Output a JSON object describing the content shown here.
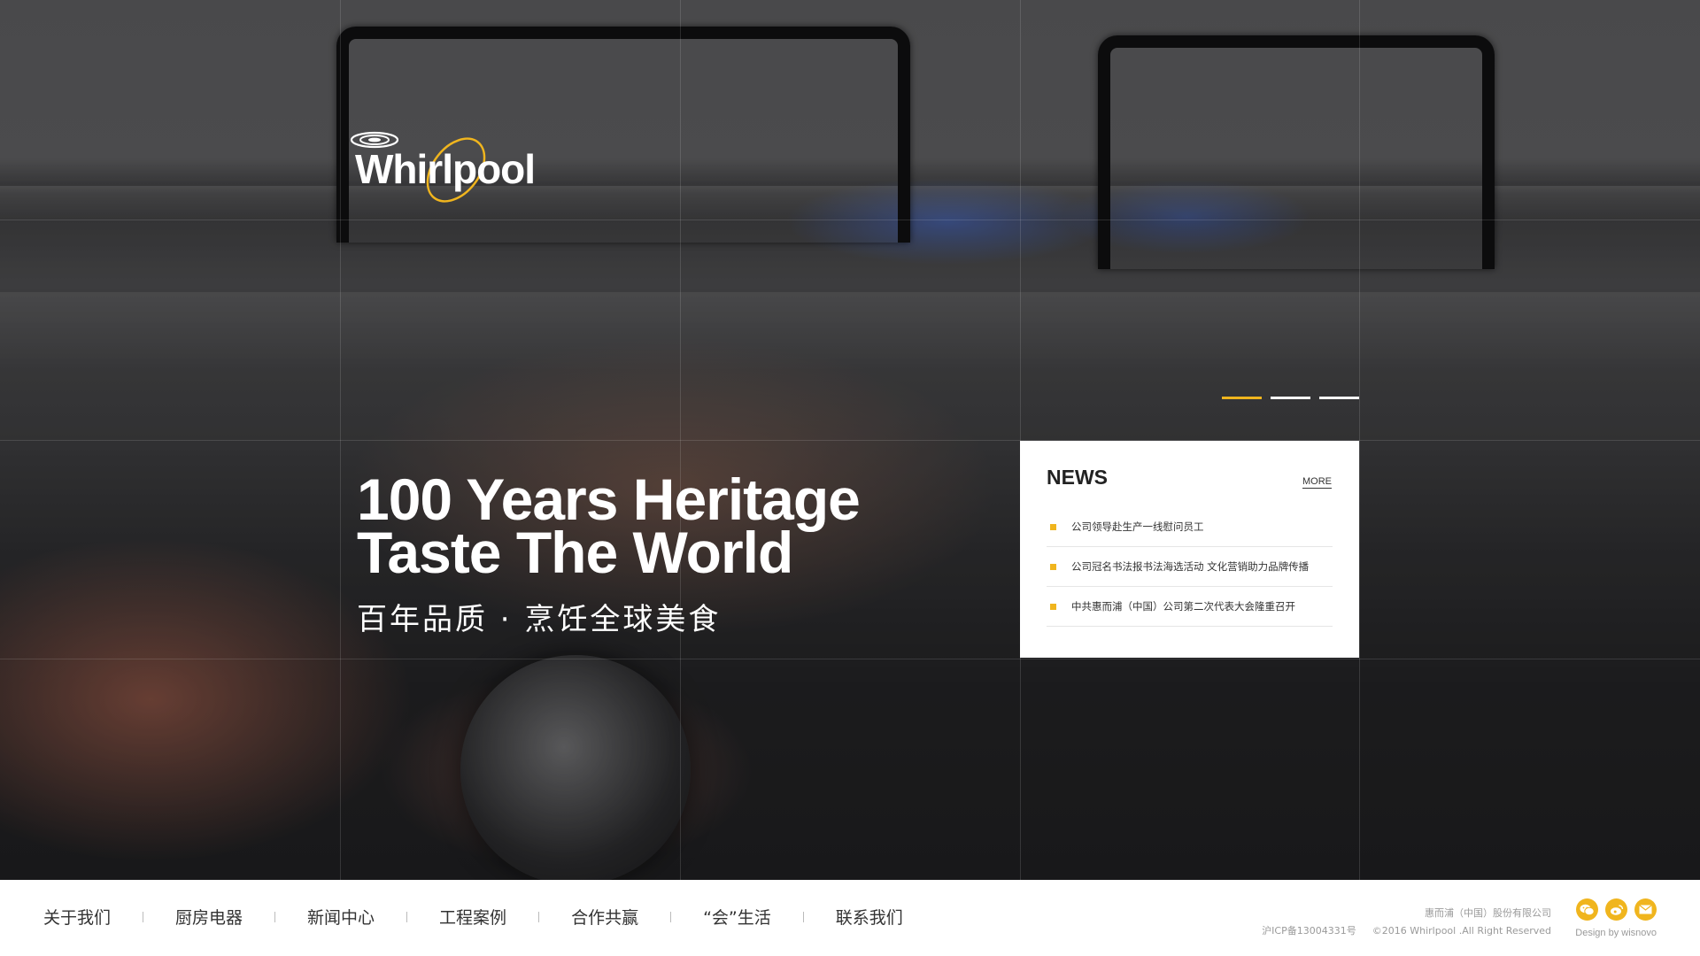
{
  "brand": {
    "logo_text": "Whirlpool"
  },
  "hero": {
    "headline_line1": "100 Years Heritage",
    "headline_line2": "Taste The World",
    "subtitle": "百年品质 · 烹饪全球美食",
    "slides_total": 3,
    "active_slide": 1
  },
  "news": {
    "title": "NEWS",
    "more_label": "MORE",
    "items": [
      {
        "title": "公司领导赴生产一线慰问员工"
      },
      {
        "title": "公司冠名书法报书法海选活动 文化营销助力品牌传播"
      },
      {
        "title": "中共惠而浦（中国）公司第二次代表大会隆重召开"
      }
    ]
  },
  "footer": {
    "nav": [
      {
        "label": "关于我们"
      },
      {
        "label": "厨房电器"
      },
      {
        "label": "新闻中心"
      },
      {
        "label": "工程案例"
      },
      {
        "label": "合作共赢"
      },
      {
        "label": "“会”生活"
      },
      {
        "label": "联系我们"
      }
    ],
    "company": "惠而浦（中国）股份有限公司",
    "icp": "沪ICP备13004331号",
    "copyright": "©2016 Whirlpool .All Right Reserved",
    "design_credit": "Design by wisnovo",
    "social": [
      {
        "name": "wechat-icon"
      },
      {
        "name": "weibo-icon"
      },
      {
        "name": "mail-icon"
      }
    ]
  },
  "colors": {
    "accent": "#f0b51e",
    "footer_bg": "#ffffff",
    "text_dark": "#333333",
    "text_muted": "#9a9a9a"
  }
}
